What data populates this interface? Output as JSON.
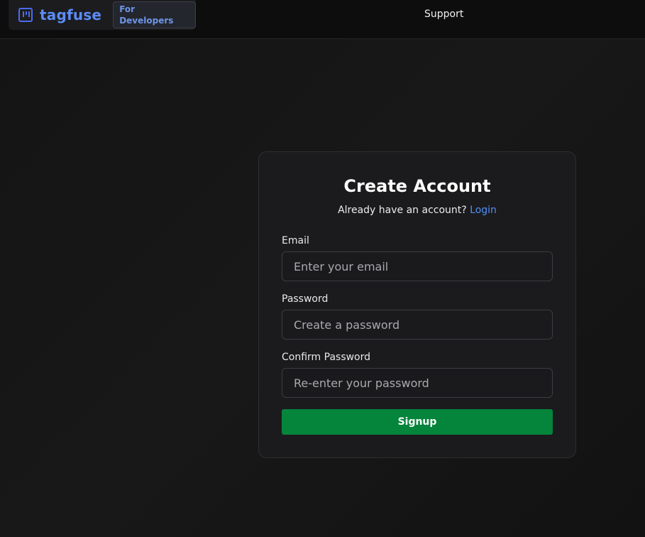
{
  "header": {
    "brand_name": "tagfuse",
    "badge": "For Developers",
    "nav_support": "Support",
    "logo_icon": "logo-icon",
    "brand_color": "#5b8bf5"
  },
  "form": {
    "title": "Create Account",
    "subtitle_text": "Already have an account?",
    "login_link": "Login",
    "email_label": "Email",
    "email_placeholder": "Enter your email",
    "password_label": "Password",
    "password_placeholder": "Create a password",
    "confirm_label": "Confirm Password",
    "confirm_placeholder": "Re-enter your password",
    "submit_label": "Signup",
    "submit_color": "#05843c",
    "link_color": "#4f8ff7"
  }
}
